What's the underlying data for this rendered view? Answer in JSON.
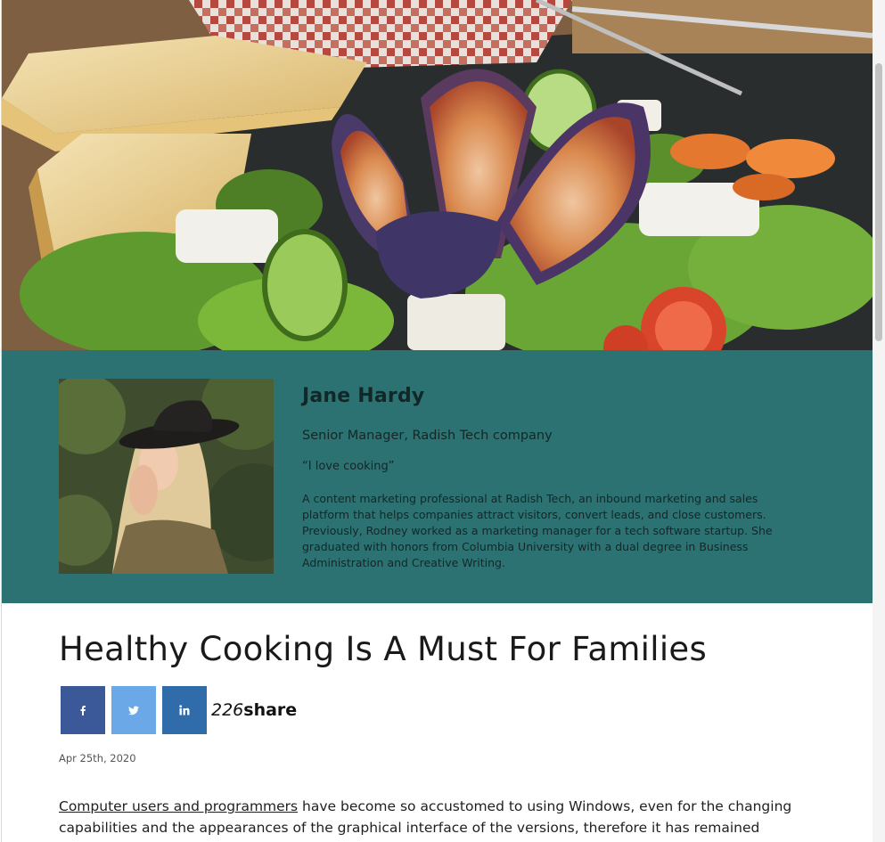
{
  "hero": {
    "image_alt": "Salad with figs, bread, cheese and vegetables"
  },
  "author": {
    "name": "Jane Hardy",
    "role": "Senior Manager, Radish Tech company",
    "quote": "“I love cooking”",
    "bio": "A content marketing professional at Radish Tech, an inbound marketing and sales platform that helps companies attract visitors, convert leads, and close customers. Previously, Rodney worked as a marketing manager for a tech software startup. She graduated with honors from Columbia University with a dual degree in Business Administration and Creative Writing."
  },
  "article": {
    "title": "Healthy Cooking Is A Must For Families",
    "share": {
      "count": "226",
      "label": "share",
      "buttons": [
        {
          "network": "facebook",
          "icon": "facebook-icon",
          "glyph": "f",
          "color": "#3b5998"
        },
        {
          "network": "twitter",
          "icon": "twitter-icon",
          "color": "#6aa8e8"
        },
        {
          "network": "linkedin",
          "icon": "linkedin-icon",
          "glyph": "in",
          "color": "#2f6ca9"
        }
      ]
    },
    "date": "Apr 25th, 2020",
    "body_link": "Computer users and programmers",
    "body_text": " have become so accustomed to using Windows, even for the changing capabilities and the appearances of the graphical interface of the versions, therefore it has remained Microsoft’s"
  },
  "colors": {
    "author_band": "#2d7272",
    "facebook": "#3b5998",
    "twitter": "#6aa8e8",
    "linkedin": "#2f6ca9"
  }
}
